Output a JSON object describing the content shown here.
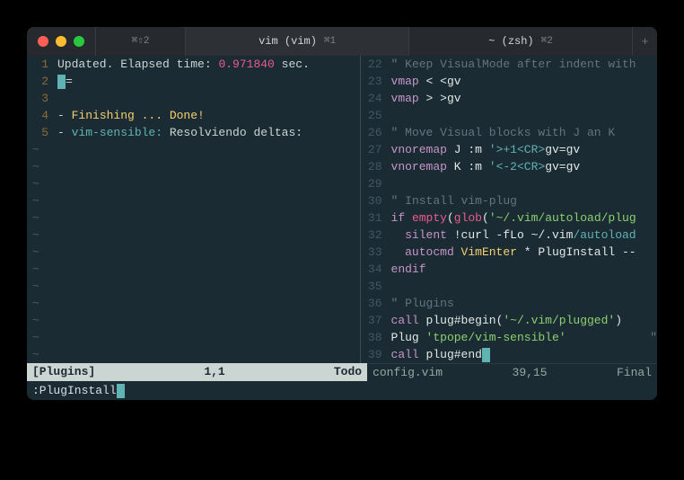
{
  "titlebar": {
    "tab0_hotkey": "⌘⇧2",
    "tab1_label": "vim (vim)",
    "tab1_hotkey": "⌘1",
    "tab2_label": "~ (zsh)",
    "tab2_hotkey": "⌘2",
    "newtab": "+"
  },
  "left": {
    "lines": [
      {
        "num": "1",
        "parts": [
          {
            "t": "Updated. Elapsed time: ",
            "c": "txt"
          },
          {
            "t": "0.971840",
            "c": "pink"
          },
          {
            "t": " sec.",
            "c": "txt"
          }
        ]
      },
      {
        "num": "2",
        "parts": [
          {
            "t": "",
            "cursor": true
          },
          {
            "t": "=",
            "c": "txt"
          }
        ]
      },
      {
        "num": "3",
        "parts": []
      },
      {
        "num": "4",
        "parts": [
          {
            "t": "- ",
            "c": "txt"
          },
          {
            "t": "Finishing ... Done!",
            "c": "yellowt"
          }
        ]
      },
      {
        "num": "5",
        "parts": [
          {
            "t": "- ",
            "c": "txt"
          },
          {
            "t": "vim-sensible: ",
            "c": "cyan"
          },
          {
            "t": "Resolviendo deltas:",
            "c": "txt"
          }
        ]
      }
    ],
    "tilde_count": 13,
    "status": {
      "left": "[Plugins]",
      "mid": "1,1",
      "right": "Todo"
    }
  },
  "right": {
    "lines": [
      {
        "num": "22",
        "parts": [
          {
            "t": "\"",
            "c": "dim"
          },
          {
            "t": " Keep VisualMode after indent with",
            "c": "dim"
          }
        ]
      },
      {
        "num": "23",
        "parts": [
          {
            "t": "vmap",
            "c": "purple"
          },
          {
            "t": " <",
            "c": "whitet"
          },
          {
            "t": " <gv",
            "c": "whitet"
          }
        ]
      },
      {
        "num": "24",
        "parts": [
          {
            "t": "vmap",
            "c": "purple"
          },
          {
            "t": " >",
            "c": "whitet"
          },
          {
            "t": " >gv",
            "c": "whitet"
          }
        ]
      },
      {
        "num": "25",
        "parts": []
      },
      {
        "num": "26",
        "parts": [
          {
            "t": "\"",
            "c": "dim"
          },
          {
            "t": " Move Visual blocks with J an K",
            "c": "dim"
          }
        ]
      },
      {
        "num": "27",
        "parts": [
          {
            "t": "vnoremap",
            "c": "purple"
          },
          {
            "t": " J :m ",
            "c": "whitet"
          },
          {
            "t": "'>+1<CR>",
            "c": "cyan"
          },
          {
            "t": "gv=gv",
            "c": "whitet"
          }
        ]
      },
      {
        "num": "28",
        "parts": [
          {
            "t": "vnoremap",
            "c": "purple"
          },
          {
            "t": " K :m ",
            "c": "whitet"
          },
          {
            "t": "'<-2<CR>",
            "c": "cyan"
          },
          {
            "t": "gv=gv",
            "c": "whitet"
          }
        ]
      },
      {
        "num": "29",
        "parts": []
      },
      {
        "num": "30",
        "parts": [
          {
            "t": "\"",
            "c": "dim"
          },
          {
            "t": " Install vim-plug",
            "c": "dim"
          }
        ]
      },
      {
        "num": "31",
        "parts": [
          {
            "t": "if",
            "c": "purple"
          },
          {
            "t": " ",
            "c": "whitet"
          },
          {
            "t": "empty",
            "c": "pink"
          },
          {
            "t": "(",
            "c": "whitet"
          },
          {
            "t": "glob",
            "c": "pink"
          },
          {
            "t": "(",
            "c": "whitet"
          },
          {
            "t": "'~/.vim/autoload/plug",
            "c": "greent"
          }
        ]
      },
      {
        "num": "32",
        "parts": [
          {
            "t": "  silent",
            "c": "purple"
          },
          {
            "t": " !curl -fLo ~/.vim",
            "c": "whitet"
          },
          {
            "t": "/autoload",
            "c": "cyan"
          }
        ]
      },
      {
        "num": "33",
        "parts": [
          {
            "t": "  autocmd",
            "c": "purple"
          },
          {
            "t": " VimEnter",
            "c": "yellowt"
          },
          {
            "t": " * PlugInstall --",
            "c": "whitet"
          }
        ]
      },
      {
        "num": "34",
        "parts": [
          {
            "t": "endif",
            "c": "purple"
          }
        ]
      },
      {
        "num": "35",
        "parts": []
      },
      {
        "num": "36",
        "parts": [
          {
            "t": "\"",
            "c": "dim"
          },
          {
            "t": " Plugins",
            "c": "dim"
          }
        ]
      },
      {
        "num": "37",
        "parts": [
          {
            "t": "call",
            "c": "purple"
          },
          {
            "t": " plug#begin(",
            "c": "whitet"
          },
          {
            "t": "'~/.vim/plugged'",
            "c": "greent"
          },
          {
            "t": ")",
            "c": "whitet"
          }
        ]
      },
      {
        "num": "38",
        "parts": [
          {
            "t": "Plug ",
            "c": "whitet"
          },
          {
            "t": "'tpope/vim-sensible'",
            "c": "greent"
          },
          {
            "t": "            \"",
            "c": "dim"
          }
        ]
      },
      {
        "num": "39",
        "parts": [
          {
            "t": "call",
            "c": "purple"
          },
          {
            "t": " plug#en",
            "c": "whitet"
          },
          {
            "t": "d",
            "c": "whitet",
            "cursor_after": true
          }
        ]
      }
    ],
    "status": {
      "left": "config.vim",
      "mid": "39,15",
      "right": "Final"
    }
  },
  "cmdline": ":PlugInstall"
}
